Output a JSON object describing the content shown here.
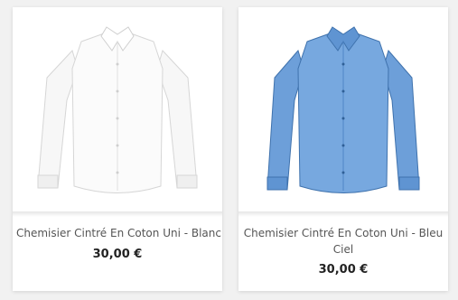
{
  "products": [
    {
      "title": "Chemisier Cintré En Coton Uni - Blanc",
      "price": "30,00 €",
      "image_icon": "white-shirt-image",
      "colors": {
        "shirt": "#f7f7f7",
        "shade": "#e2e2e2",
        "stroke": "#cfcfcf"
      }
    },
    {
      "title": "Chemisier Cintré En Coton Uni - Bleu Ciel",
      "price": "30,00 €",
      "image_icon": "blue-shirt-image",
      "colors": {
        "shirt": "#6d9fd9",
        "shade": "#4f86c7",
        "stroke": "#3f72ad"
      }
    }
  ]
}
